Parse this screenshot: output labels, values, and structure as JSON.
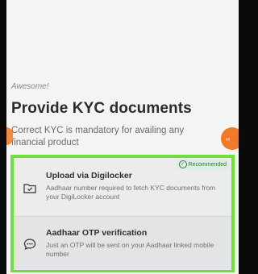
{
  "header": {
    "subtitle": "Awesome!",
    "title": "Provide KYC documents",
    "description": "Correct KYC is mandatory for availing any financial product"
  },
  "side_button": {
    "label": "‹‹"
  },
  "options": [
    {
      "title": "Upload via Digilocker",
      "description": "Aadhaar number required to fetch KYC documents from your DigiLocker account",
      "badge": "Recommended",
      "icon": "folder-check-icon"
    },
    {
      "title": "Aadhaar OTP verification",
      "description": "Just an OTP will be sent on your Aadhaar linked mobile number",
      "icon": "chat-bubble-icon"
    }
  ],
  "colors": {
    "accent_orange": "#f07a2a",
    "highlight_green": "#6fe03a",
    "badge_green": "#2f7a3c"
  }
}
